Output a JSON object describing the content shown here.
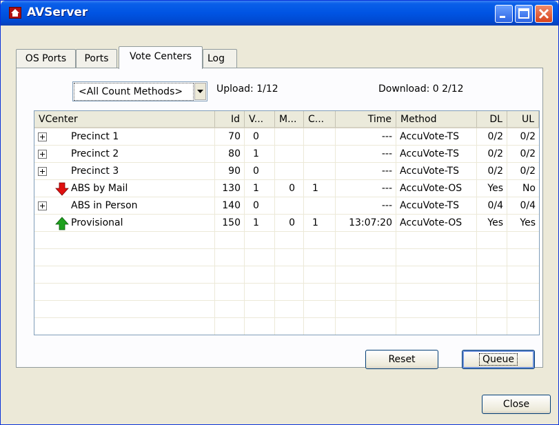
{
  "window": {
    "title": "AVServer"
  },
  "tabs": [
    {
      "label": "OS Ports"
    },
    {
      "label": "Ports"
    },
    {
      "label": "Vote Centers"
    },
    {
      "label": "Log"
    }
  ],
  "toolbar": {
    "count_method": "<All Count Methods>",
    "upload": "Upload:  1/12",
    "download": "Download:  0 2/12"
  },
  "list": {
    "columns": [
      "VCenter",
      "Id",
      "V...",
      "M...",
      "C...",
      "Time",
      "Method",
      "DL",
      "UL"
    ],
    "rows": [
      {
        "icon": "expand-plus-icon",
        "name": "Precinct 1",
        "id": "70",
        "v": "0",
        "m": "",
        "c": "",
        "time": "---",
        "method": "AccuVote-TS",
        "dl": "0/2",
        "ul": "0/2"
      },
      {
        "icon": "expand-plus-icon",
        "name": "Precinct 2",
        "id": "80",
        "v": "1",
        "m": "",
        "c": "",
        "time": "---",
        "method": "AccuVote-TS",
        "dl": "0/2",
        "ul": "0/2"
      },
      {
        "icon": "expand-plus-icon",
        "name": "Precinct 3",
        "id": "90",
        "v": "0",
        "m": "",
        "c": "",
        "time": "---",
        "method": "AccuVote-TS",
        "dl": "0/2",
        "ul": "0/2"
      },
      {
        "icon": "red-down-arrow-icon",
        "name": "ABS by Mail",
        "id": "130",
        "v": "1",
        "m": "0",
        "c": "1",
        "time": "---",
        "method": "AccuVote-OS",
        "dl": "Yes",
        "ul": "No"
      },
      {
        "icon": "expand-plus-icon",
        "name": "ABS in Person",
        "id": "140",
        "v": "0",
        "m": "",
        "c": "",
        "time": "---",
        "method": "AccuVote-TS",
        "dl": "0/4",
        "ul": "0/4"
      },
      {
        "icon": "green-up-arrow-icon",
        "name": "Provisional",
        "id": "150",
        "v": "1",
        "m": "0",
        "c": "1",
        "time": "13:07:20",
        "method": "AccuVote-OS",
        "dl": "Yes",
        "ul": "Yes"
      }
    ]
  },
  "buttons": {
    "reset": "Reset",
    "queue": "Queue",
    "close": "Close"
  },
  "colors": {
    "titlebar": "#0054e3",
    "arrow_down": "#e01010",
    "arrow_up": "#1ea01e"
  }
}
